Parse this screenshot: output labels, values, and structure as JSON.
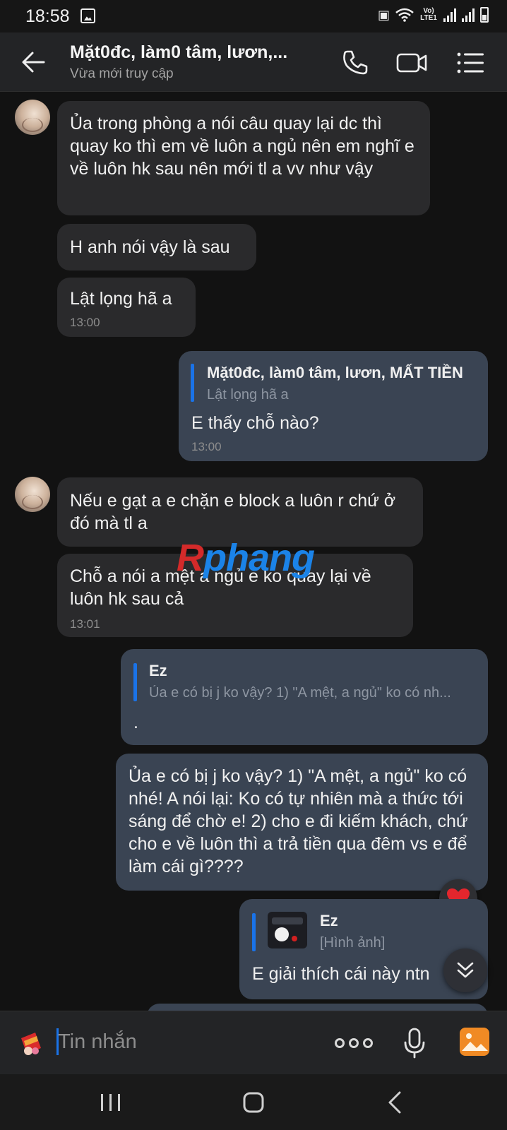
{
  "status_bar": {
    "time": "18:58",
    "lte_label": "Vo) LTE1"
  },
  "header": {
    "title": "Mặt0đc, làm0 tâm, lươn,...",
    "subtitle": "Vừa mới truy cập"
  },
  "watermark": {
    "first": "R",
    "rest": "phang"
  },
  "messages": [
    {
      "direction": "in",
      "text": "Ủa trong phòng a nói câu quay lại dc thì quay ko thì em về luôn a ngủ nên em nghĩ e về luôn hk sau nên mới tl a vv như vậy"
    },
    {
      "direction": "in",
      "text": "H anh nói vậy là sau"
    },
    {
      "direction": "in",
      "text": "Lật lọng hã a",
      "time": "13:00"
    },
    {
      "direction": "out",
      "quote_name": "Mặt0đc, làm0 tâm, lươn, MẤT TIỀN",
      "quote_text": "Lật lọng hã a",
      "text": "E thấy chỗ nào?",
      "time": "13:00"
    },
    {
      "direction": "in",
      "text": "Nếu e gạt a e chặn e block a luôn r chứ ở đó mà tl a"
    },
    {
      "direction": "in",
      "text": "Chỗ a nói a mệt a ngủ e ko quay lại về luôn hk sau cả",
      "time": "13:01"
    },
    {
      "direction": "out",
      "quote_name": "Ez",
      "quote_text": "Ủa e có bị j ko vậy? 1) \"A mệt, a ngủ\" ko có nh...",
      "text": "."
    },
    {
      "direction": "out",
      "text": "Ủa e có bị j ko vậy? 1) \"A mệt, a ngủ\" ko có nhé! A nói lại: Ko có tự nhiên mà a thức tới sáng để chờ e! 2) cho e đi kiếm khách, chứ cho e về luôn thì a trả tiền qua đêm vs e để làm cái gì????",
      "reaction": "heart"
    },
    {
      "direction": "out",
      "quote_name": "Ez",
      "quote_text": "[Hình ảnh]",
      "text": "E giải thích cái này ntn"
    }
  ],
  "composer": {
    "placeholder": "Tin nhắn",
    "value": ""
  },
  "colors": {
    "accent": "#1a73e8",
    "bubble_in": "#2a2a2c",
    "bubble_out": "#3a4453",
    "background": "#121212"
  }
}
